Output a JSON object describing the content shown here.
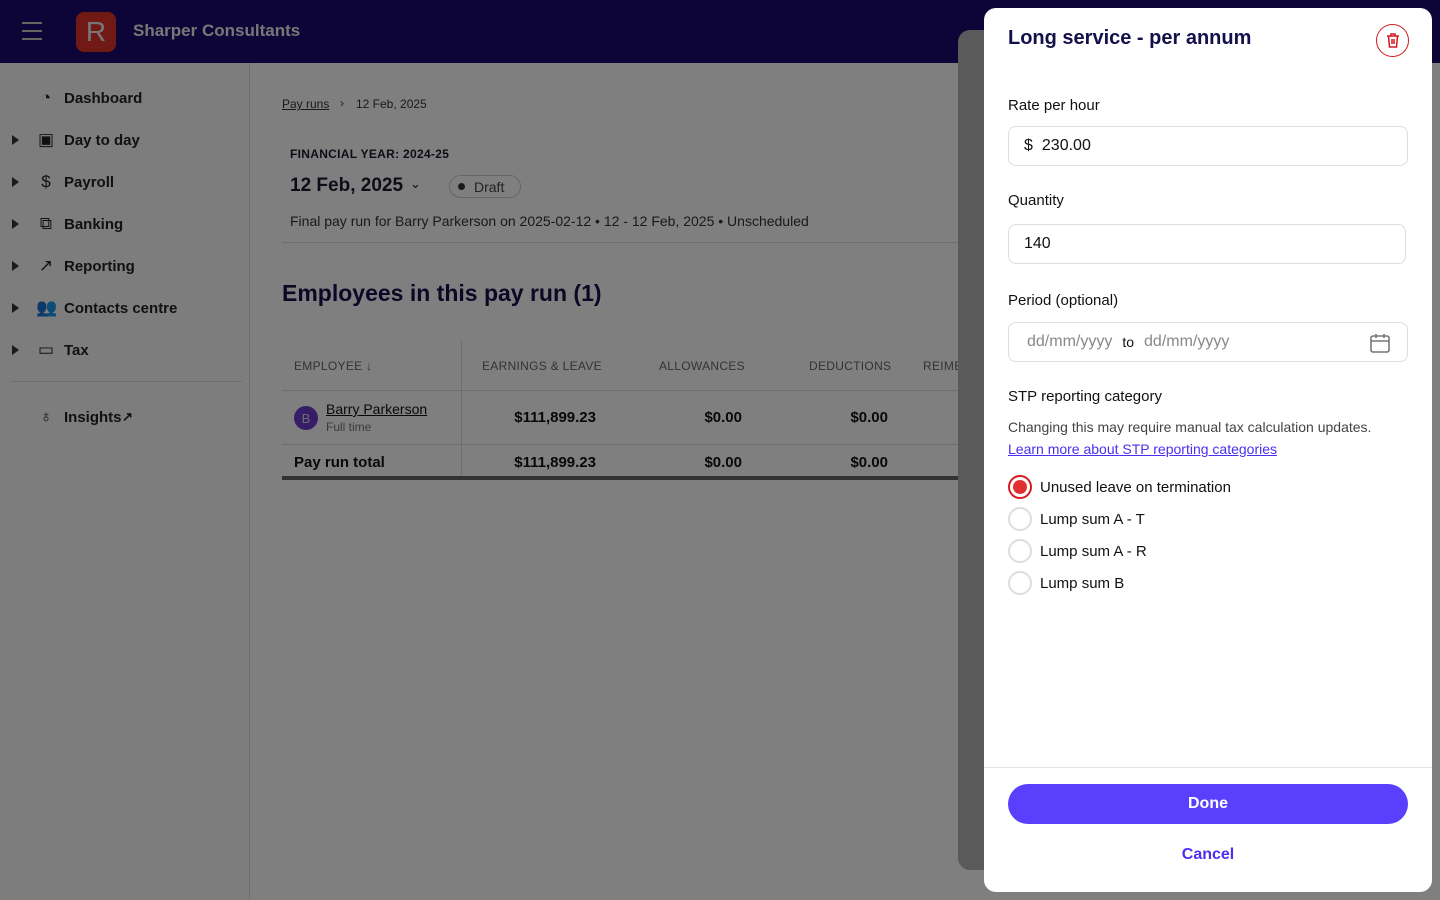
{
  "header": {
    "org_name": "Sharper Consultants",
    "logo_letter": "R"
  },
  "sidebar": {
    "items": [
      {
        "label": "Dashboard",
        "icon": "pie-chart-icon"
      },
      {
        "label": "Day to day",
        "icon": "calendar-icon"
      },
      {
        "label": "Payroll",
        "icon": "dollar-icon"
      },
      {
        "label": "Banking",
        "icon": "briefcase-icon"
      },
      {
        "label": "Reporting",
        "icon": "trend-icon"
      },
      {
        "label": "Contacts centre",
        "icon": "users-icon"
      },
      {
        "label": "Tax",
        "icon": "archive-icon"
      },
      {
        "label": "Insights",
        "icon": "lightbulb-icon"
      }
    ]
  },
  "main": {
    "breadcrumb": {
      "parent": "Pay runs",
      "current": "12 Feb, 2025"
    },
    "financial_year": "FINANCIAL YEAR: 2024-25",
    "date": "12 Feb, 2025",
    "status": "Draft",
    "description": "Final pay run for Barry Parkerson on 2025-02-12 • 12 - 12 Feb, 2025 • Unscheduled",
    "section_title": "Employees in this pay run (1)",
    "table": {
      "headers": [
        "EMPLOYEE ↓",
        "EARNINGS & LEAVE",
        "ALLOWANCES",
        "DEDUCTIONS",
        "REIME"
      ],
      "rows": [
        {
          "avatar": "B",
          "name": "Barry Parkerson",
          "type": "Full time",
          "earnings": "$111,899.23",
          "allowances": "$0.00",
          "deductions": "$0.00"
        }
      ],
      "total": {
        "label": "Pay run total",
        "earnings": "$111,899.23",
        "allowances": "$0.00",
        "deductions": "$0.00"
      }
    }
  },
  "modal": {
    "title": "Long service - per annum",
    "rate_label": "Rate per hour",
    "rate_prefix": "$",
    "rate_value": "230.00",
    "quantity_label": "Quantity",
    "quantity_value": "140",
    "period_label": "Period (optional)",
    "period_from_placeholder": "dd/mm/yyyy",
    "period_to": "to",
    "period_to_placeholder": "dd/mm/yyyy",
    "stp_label": "STP reporting category",
    "stp_note": "Changing this may require manual tax calculation updates.",
    "stp_link": "Learn more about STP reporting categories",
    "options": [
      "Unused leave on termination",
      "Lump sum A - T",
      "Lump sum A - R",
      "Lump sum B"
    ],
    "selected": "Unused leave on termination",
    "done": "Done",
    "cancel": "Cancel",
    "colors": {
      "primary": "#5a3ffc",
      "danger": "#d71920"
    }
  }
}
